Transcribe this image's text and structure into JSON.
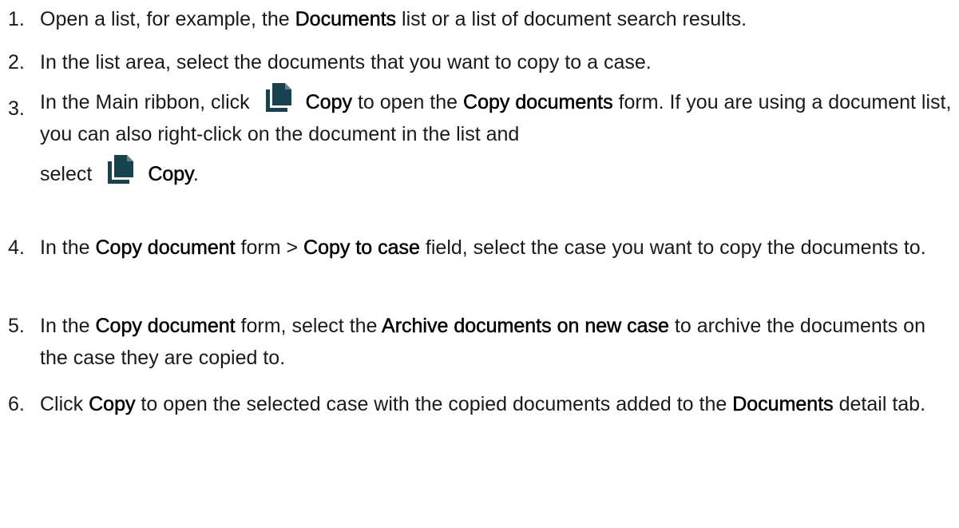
{
  "steps": [
    {
      "num": "1.",
      "parts": [
        "Open a list, for example, the ",
        "Documents",
        " list or a list of document search results."
      ]
    },
    {
      "num": "2.",
      "parts": [
        "In the list area, select the documents that you want to copy to a case."
      ]
    },
    {
      "num": "3.",
      "parts": [
        "In the Main ribbon, click",
        "Copy",
        " to open the ",
        "Copy documents",
        " form. If you are using a document list, you can also right-click on the document in the list and",
        "select",
        "Copy",
        "."
      ]
    },
    {
      "num": "4.",
      "parts": [
        "In the ",
        "Copy document",
        " form > ",
        "Copy to case",
        " field, select the case you want to copy the documents to."
      ]
    },
    {
      "num": "5.",
      "parts": [
        "In the ",
        "Copy document",
        " form, select the ",
        "Archive documents on new case",
        " to archive the documents on the case they are copied to."
      ]
    },
    {
      "num": "6.",
      "parts": [
        "Click ",
        "Copy",
        " to open the selected case with the copied documents added to the ",
        "Documents",
        " detail tab."
      ]
    }
  ],
  "icons": {
    "copy": "copy-documents-icon",
    "color": "#17424f"
  }
}
